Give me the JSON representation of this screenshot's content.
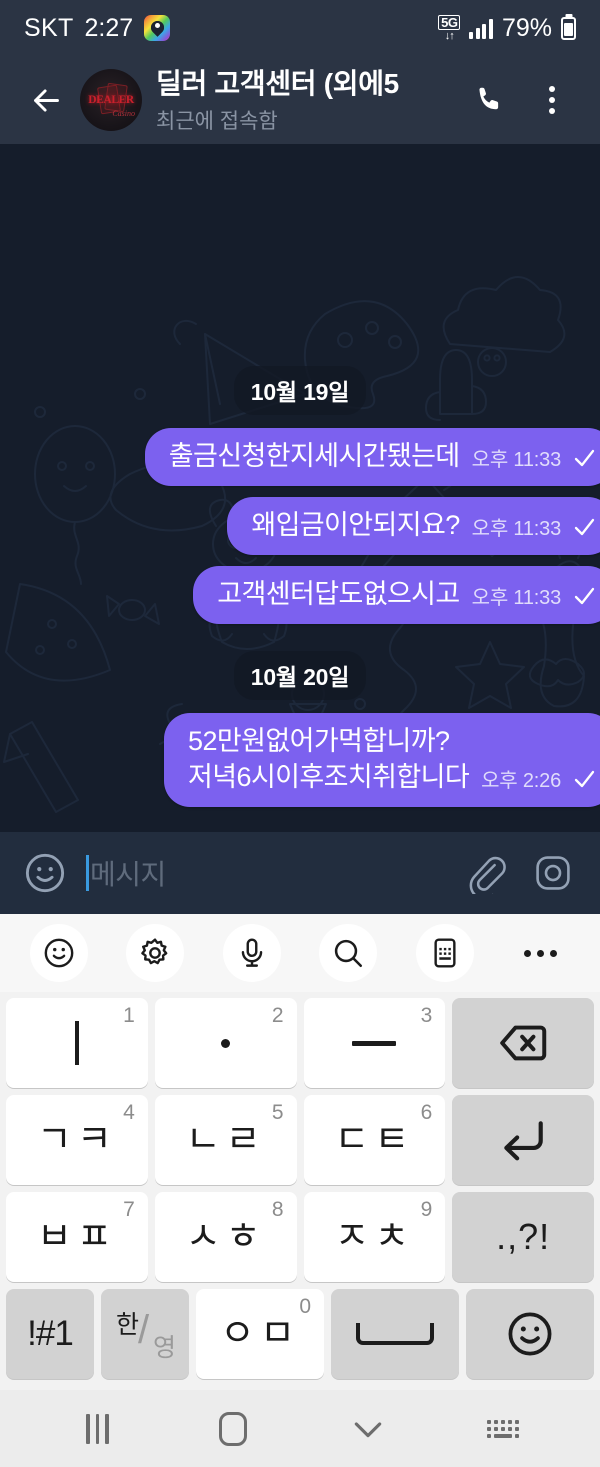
{
  "status_bar": {
    "carrier": "SKT",
    "clock": "2:27",
    "app_icon": "location-pin-app-icon",
    "network": "5G",
    "battery_percent": "79%",
    "signal_icon": "signal-bars-icon",
    "battery_icon": "battery-icon"
  },
  "header": {
    "back_icon": "back-arrow-icon",
    "avatar": {
      "name": "group-avatar",
      "logo_text": "DEALER",
      "logo_sub": "Casino"
    },
    "title": "딜러 고객센터 (외에5",
    "subtitle": "최근에 접속함",
    "call_icon": "phone-icon",
    "menu_icon": "more-vertical-icon"
  },
  "chat": {
    "background": "#151d2b",
    "bubble_color": "#7c61ef",
    "groups": [
      {
        "date": "10월 19일",
        "messages": [
          {
            "text": "출금신청한지세시간됐는데",
            "time": "오후 11:33",
            "status": "sent"
          },
          {
            "text": "왜입금이안되지요?",
            "time": "오후 11:33",
            "status": "sent"
          },
          {
            "text": "고객센터답도없으시고",
            "time": "오후 11:33",
            "status": "sent"
          }
        ]
      },
      {
        "date": "10월 20일",
        "messages": [
          {
            "text": "52만원없어가먹합니까?\n저녁6시이후조치취합니다",
            "time": "오후 2:26",
            "status": "sent"
          }
        ]
      }
    ]
  },
  "input_bar": {
    "emoji_icon": "emoji-face-icon",
    "placeholder": "메시지",
    "value": "",
    "attach_icon": "paperclip-icon",
    "camera_icon": "camera-icon"
  },
  "keyboard": {
    "toolbar": [
      {
        "icon": "sticker-smiley-icon",
        "name": "kb-sticker-button"
      },
      {
        "icon": "gear-icon",
        "name": "kb-settings-button"
      },
      {
        "icon": "microphone-icon",
        "name": "kb-voice-button"
      },
      {
        "icon": "search-icon",
        "name": "kb-search-button"
      },
      {
        "icon": "clipboard-icon",
        "name": "kb-clipboard-button"
      },
      {
        "icon": "more-horizontal-icon",
        "name": "kb-more-button"
      }
    ],
    "rows": [
      [
        {
          "glyph": "ㅣ",
          "num": "1",
          "type": "letter"
        },
        {
          "glyph": "·",
          "num": "2",
          "type": "letter"
        },
        {
          "glyph": "ㅡ",
          "num": "3",
          "type": "letter"
        },
        {
          "glyph": "",
          "num": "",
          "type": "backspace",
          "label": "backspace"
        }
      ],
      [
        {
          "glyph": "ㄱㅋ",
          "num": "4",
          "type": "letter"
        },
        {
          "glyph": "ㄴㄹ",
          "num": "5",
          "type": "letter"
        },
        {
          "glyph": "ㄷㅌ",
          "num": "6",
          "type": "letter"
        },
        {
          "glyph": "",
          "num": "",
          "type": "enter",
          "label": "enter"
        }
      ],
      [
        {
          "glyph": "ㅂㅍ",
          "num": "7",
          "type": "letter"
        },
        {
          "glyph": "ㅅㅎ",
          "num": "8",
          "type": "letter"
        },
        {
          "glyph": "ㅈㅊ",
          "num": "9",
          "type": "letter"
        },
        {
          "glyph": ".,?!",
          "num": "",
          "type": "punct"
        }
      ],
      [
        {
          "glyph": "!#1",
          "num": "",
          "type": "symbols"
        },
        {
          "glyph": "한/영",
          "num": "",
          "type": "lang",
          "lang_a": "한",
          "lang_b": "영"
        },
        {
          "glyph": "ㅇㅁ",
          "num": "0",
          "type": "letter"
        },
        {
          "glyph": "",
          "num": "",
          "type": "space",
          "label": "space"
        },
        {
          "glyph": "",
          "num": "",
          "type": "emoji",
          "label": "emoji"
        }
      ]
    ]
  },
  "nav_bar": {
    "recents_icon": "recents-icon",
    "home_icon": "home-icon",
    "hide_keyboard_icon": "chevron-down-icon",
    "switch_keyboard_icon": "keyboard-icon"
  }
}
